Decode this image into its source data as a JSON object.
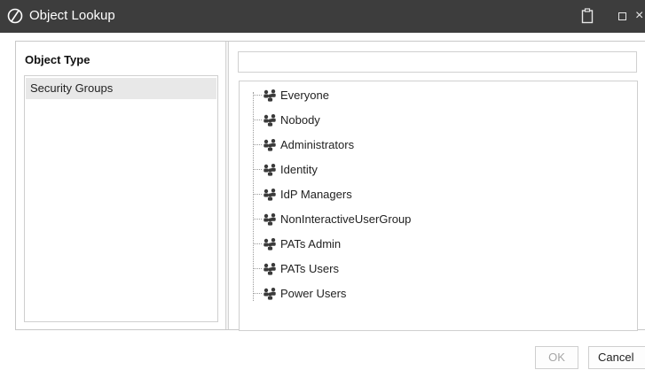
{
  "window": {
    "title": "Object Lookup",
    "logo_icon": "circle-slash-logo-icon",
    "controls": [
      "clipboard-icon",
      "maximize-icon",
      "close-icon"
    ],
    "close_glyph": "×"
  },
  "object_type_panel": {
    "heading": "Object Type",
    "items": [
      {
        "label": "Security Groups",
        "selected": true
      }
    ]
  },
  "search": {
    "value": "",
    "placeholder": ""
  },
  "tree": {
    "node_icon": "group-users-icon",
    "items": [
      {
        "label": "Everyone"
      },
      {
        "label": "Nobody"
      },
      {
        "label": "Administrators"
      },
      {
        "label": "Identity"
      },
      {
        "label": "IdP Managers"
      },
      {
        "label": "NonInteractiveUserGroup"
      },
      {
        "label": "PATs Admin"
      },
      {
        "label": "PATs Users"
      },
      {
        "label": "Power Users"
      }
    ]
  },
  "footer": {
    "ok_label": "OK",
    "ok_enabled": false,
    "cancel_label": "Cancel"
  },
  "colors": {
    "titlebar": "#3d3d3d",
    "selected_item": "#e8e8e8",
    "group_icon": "#3a3a3a"
  }
}
